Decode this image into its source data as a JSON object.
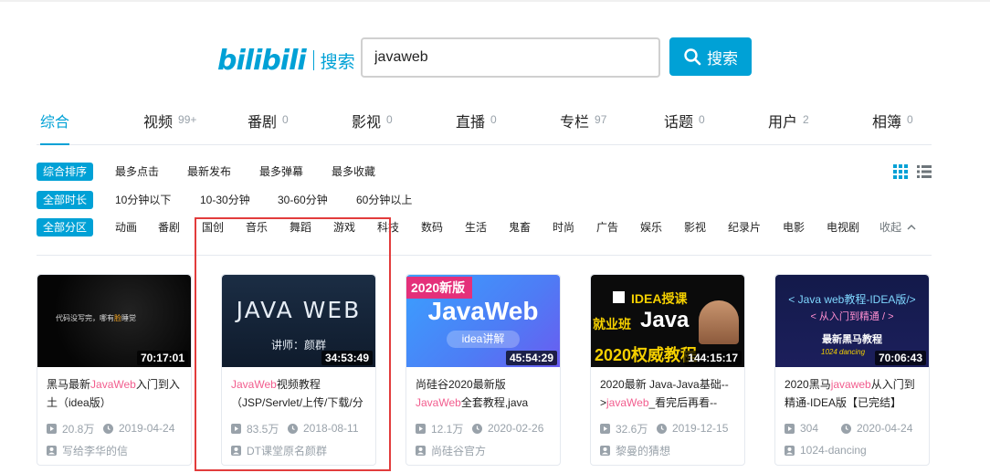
{
  "logo": {
    "brand": "bilibili",
    "subtitle": "搜索"
  },
  "search": {
    "query": "javaweb",
    "button_label": "搜索"
  },
  "tabs": [
    {
      "label": "综合",
      "count": ""
    },
    {
      "label": "视频",
      "count": "99+"
    },
    {
      "label": "番剧",
      "count": "0"
    },
    {
      "label": "影视",
      "count": "0"
    },
    {
      "label": "直播",
      "count": "0"
    },
    {
      "label": "专栏",
      "count": "97"
    },
    {
      "label": "话题",
      "count": "0"
    },
    {
      "label": "用户",
      "count": "2"
    },
    {
      "label": "相簿",
      "count": "0"
    }
  ],
  "filters": {
    "sort": {
      "tag": "综合排序",
      "options": [
        "最多点击",
        "最新发布",
        "最多弹幕",
        "最多收藏"
      ]
    },
    "duration": {
      "tag": "全部时长",
      "options": [
        "10分钟以下",
        "10-30分钟",
        "30-60分钟",
        "60分钟以上"
      ]
    },
    "zone": {
      "tag": "全部分区",
      "options": [
        "动画",
        "番剧",
        "国创",
        "音乐",
        "舞蹈",
        "游戏",
        "科技",
        "数码",
        "生活",
        "鬼畜",
        "时尚",
        "广告",
        "娱乐",
        "影视",
        "纪录片",
        "电影",
        "电视剧"
      ],
      "collapse": "收起"
    }
  },
  "thumb_text": {
    "c1": {
      "line": "代码没写完，哪有",
      "hl": "脸",
      "tail": "睡觉"
    },
    "c2": {
      "main": "JAVA WEB",
      "sub": "讲师：颜群"
    },
    "c3": {
      "badge": "2020新版",
      "main": "JavaWeb",
      "pill": "idea讲解"
    },
    "c4": {
      "l1": "IDEA授课",
      "l2a": "就业班",
      "l2b": "Java",
      "l3": "2020权威教程"
    },
    "c5": {
      "l1": "< Java web教程-IDEA版/>",
      "l2": "< 从入门到精通 / >",
      "l3": "最新黑马教程",
      "l4": "1024 dancing"
    }
  },
  "cards": [
    {
      "duration": "70:17:01",
      "title_pre": "黑马最新",
      "title_hl": "JavaWeb",
      "title_post": "入门到入土（idea版）",
      "views": "20.8万",
      "date": "2019-04-24",
      "uploader": "写给李华的信"
    },
    {
      "duration": "34:53:49",
      "title_pre": "",
      "title_hl": "JavaWeb",
      "title_post": "视频教程（JSP/Servlet/上传/下载/分",
      "views": "83.5万",
      "date": "2018-08-11",
      "uploader": "DT课堂原名颜群"
    },
    {
      "duration": "45:54:29",
      "title_pre": "尚硅谷2020最新版",
      "title_hl": "JavaWeb",
      "title_post": "全套教程,java",
      "views": "12.1万",
      "date": "2020-02-26",
      "uploader": "尚硅谷官方"
    },
    {
      "duration": "144:15:17",
      "title_pre": "2020最新 Java-Java基础-->",
      "title_hl": "javaWeb",
      "title_post": "_看完后再看--",
      "views": "32.6万",
      "date": "2019-12-15",
      "uploader": "黎曼的猜想"
    },
    {
      "duration": "70:06:43",
      "title_pre": "2020黑马",
      "title_hl": "javaweb",
      "title_post": "从入门到精通-IDEA版【已完结】",
      "views": "304",
      "date": "2020-04-24",
      "uploader": "1024-dancing"
    }
  ]
}
